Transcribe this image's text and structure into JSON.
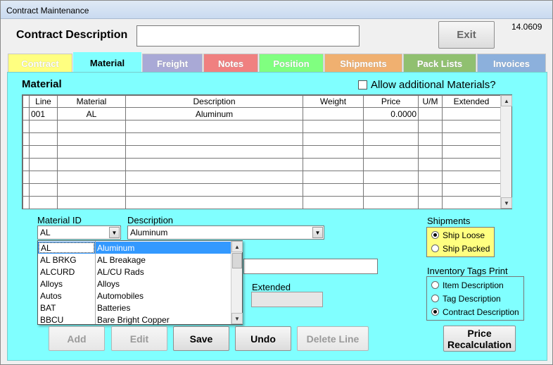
{
  "window": {
    "title": "Contract Maintenance",
    "version": "14.0609"
  },
  "header": {
    "contract_description_label": "Contract Description",
    "contract_description_value": "",
    "exit_label": "Exit"
  },
  "tabs": [
    {
      "label": "Contract",
      "color": "#ffff80"
    },
    {
      "label": "Material",
      "color": "#80ffff"
    },
    {
      "label": "Freight",
      "color": "#a9a9d6"
    },
    {
      "label": "Notes",
      "color": "#f08080"
    },
    {
      "label": "Position",
      "color": "#80ff80"
    },
    {
      "label": "Shipments",
      "color": "#f0b070"
    },
    {
      "label": "Pack Lists",
      "color": "#90c070"
    },
    {
      "label": "Invoices",
      "color": "#8cb0dc"
    }
  ],
  "material": {
    "heading": "Material",
    "allow_additional_label": "Allow additional Materials?",
    "columns": [
      "Line",
      "Material",
      "Description",
      "Weight",
      "Price",
      "U/M",
      "Extended"
    ],
    "rows": [
      {
        "line": "001",
        "material": "AL",
        "description": "Aluminum",
        "weight": "",
        "price": "0.0000",
        "um": "",
        "extended": ""
      }
    ]
  },
  "form": {
    "material_id_label": "Material ID",
    "material_id_value": "AL",
    "description_label": "Description",
    "description_value": "Aluminum",
    "extended_label": "Extended",
    "extended_value": ""
  },
  "dropdown": {
    "items": [
      {
        "id": "AL",
        "desc": "Aluminum",
        "selected": true
      },
      {
        "id": "AL BRKG",
        "desc": "AL Breakage"
      },
      {
        "id": "ALCURD",
        "desc": "AL/CU Rads"
      },
      {
        "id": "Alloys",
        "desc": "Alloys"
      },
      {
        "id": "Autos",
        "desc": "Automobiles"
      },
      {
        "id": "BAT",
        "desc": "Batteries"
      },
      {
        "id": "BBCU",
        "desc": "Bare Bright Copper"
      }
    ]
  },
  "shipments": {
    "label": "Shipments",
    "options": [
      "Ship Loose",
      "Ship Packed"
    ],
    "selected": "Ship Loose"
  },
  "inventory_tags": {
    "label": "Inventory Tags Print",
    "options": [
      "Item Description",
      "Tag Description",
      "Contract Description"
    ],
    "selected": "Contract Description"
  },
  "buttons": {
    "add": "Add",
    "edit": "Edit",
    "save": "Save",
    "undo": "Undo",
    "delete_line": "Delete Line",
    "price_recalc_1": "Price",
    "price_recalc_2": "Recalculation"
  }
}
